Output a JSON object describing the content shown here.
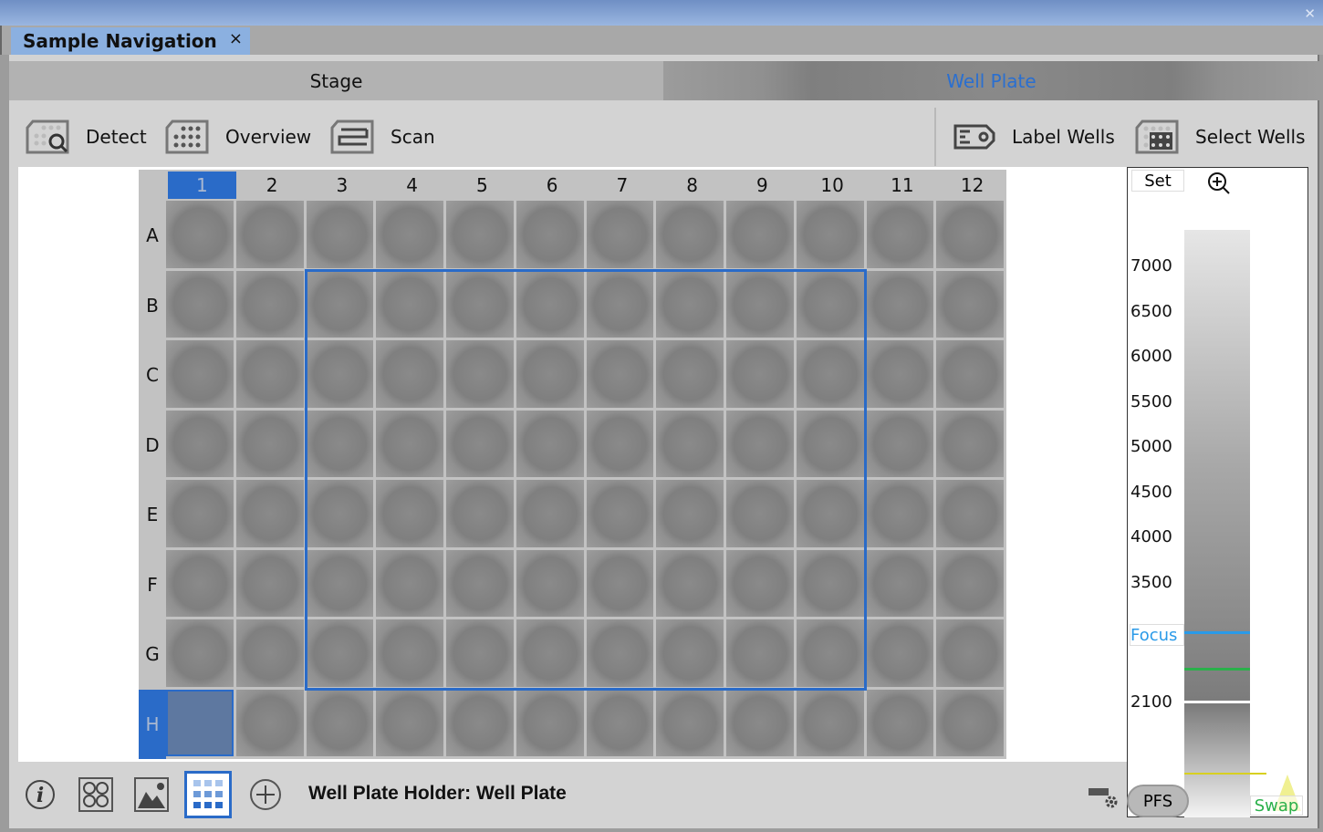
{
  "window": {
    "close_icon": "close-icon"
  },
  "tab": {
    "title": "Sample Navigation",
    "close": "×"
  },
  "segments": {
    "stage": "Stage",
    "well_plate": "Well Plate"
  },
  "toolbar": {
    "detect": "Detect",
    "overview": "Overview",
    "scan": "Scan",
    "label_wells": "Label Wells",
    "select_wells": "Select Wells"
  },
  "plate": {
    "columns": [
      "1",
      "2",
      "3",
      "4",
      "5",
      "6",
      "7",
      "8",
      "9",
      "10",
      "11",
      "12"
    ],
    "rows": [
      "A",
      "B",
      "C",
      "D",
      "E",
      "F",
      "G",
      "H"
    ],
    "selected_column": "1",
    "selected_row": "H",
    "current_well": "H1",
    "selection": {
      "from": "B3",
      "to": "G10"
    }
  },
  "zpanel": {
    "set": "Set",
    "ticks": [
      "7000",
      "6500",
      "6000",
      "5500",
      "5000",
      "4500",
      "4000",
      "3500"
    ],
    "focus": "Focus",
    "lower_tick": "2100",
    "pfs": "PFS",
    "swap": "Swap"
  },
  "colors": {
    "accent": "#2a6bc8",
    "focus": "#2a9ae8",
    "green": "#2ab04a",
    "yellow": "#d8d020"
  },
  "status": {
    "text": "Well Plate Holder: Well Plate"
  }
}
